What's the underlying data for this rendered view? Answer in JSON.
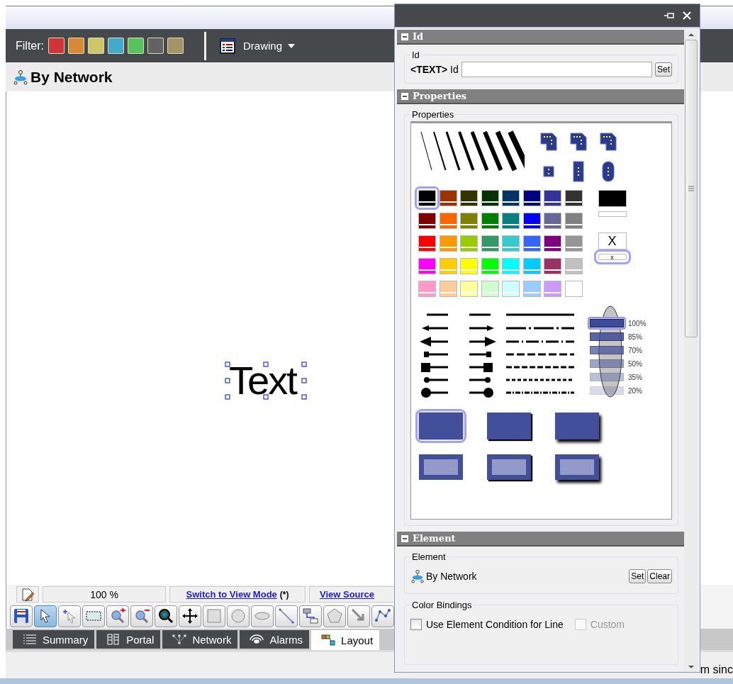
{
  "toolbar": {
    "filter_label": "Filter:",
    "filters": [
      {
        "color": "#d03434"
      },
      {
        "color": "#d88a34"
      },
      {
        "color": "#cfc66a"
      },
      {
        "color": "#44aacc"
      },
      {
        "color": "#56c45a"
      },
      {
        "color": "#626262"
      },
      {
        "color": "#a59468"
      }
    ],
    "view_menu": "Drawing"
  },
  "page_title": "By Network",
  "canvas": {
    "text_element": "Text",
    "selected": true
  },
  "status_row": {
    "zoom": "100 %",
    "switch_link": "Switch to View Mode",
    "switch_suffix": "(*)",
    "source_link": "View Source"
  },
  "tools": [
    {
      "kind": "save",
      "selected": false
    },
    {
      "kind": "pointer",
      "selected": true
    },
    {
      "kind": "add_pointer",
      "selected": false
    },
    {
      "kind": "marquee",
      "selected": false
    },
    {
      "kind": "zoom_in",
      "selected": false
    },
    {
      "kind": "zoom_out",
      "selected": false
    },
    {
      "kind": "zoom_fit",
      "selected": false
    },
    {
      "kind": "move",
      "selected": false
    },
    {
      "kind": "rectangle",
      "selected": false
    },
    {
      "kind": "circle",
      "selected": false
    },
    {
      "kind": "ellipse",
      "selected": false
    },
    {
      "kind": "line",
      "selected": false
    },
    {
      "kind": "connector",
      "selected": false
    },
    {
      "kind": "polygon",
      "selected": false
    },
    {
      "kind": "arrow",
      "selected": false
    },
    {
      "kind": "polyline",
      "selected": false
    }
  ],
  "tabs": [
    {
      "kind": "summary",
      "label": "Summary",
      "selected": false
    },
    {
      "kind": "portal",
      "label": "Portal",
      "selected": false
    },
    {
      "kind": "network",
      "label": "Network",
      "selected": false
    },
    {
      "kind": "alarms",
      "label": "Alarms",
      "selected": false
    },
    {
      "kind": "layout",
      "label": "Layout",
      "selected": true
    }
  ],
  "status_bar": {
    "text": "m sinc"
  },
  "panel": {
    "id_section": {
      "title": "Id",
      "group": "Id",
      "prefix": "<TEXT>",
      "label": "Id",
      "button": "Set"
    },
    "properties_section": {
      "title": "Properties",
      "group": "Properties",
      "colors": [
        {
          "color": "#000000",
          "selected": true
        },
        {
          "color": "#993300",
          "selected": false
        },
        {
          "color": "#333300",
          "selected": false
        },
        {
          "color": "#003300",
          "selected": false
        },
        {
          "color": "#003366",
          "selected": false
        },
        {
          "color": "#000080",
          "selected": false
        },
        {
          "color": "#333399",
          "selected": false
        },
        {
          "color": "#333333",
          "selected": false
        },
        {
          "color": "#800000",
          "selected": false
        },
        {
          "color": "#ff6600",
          "selected": false
        },
        {
          "color": "#808000",
          "selected": false
        },
        {
          "color": "#008000",
          "selected": false
        },
        {
          "color": "#008080",
          "selected": false
        },
        {
          "color": "#0000ff",
          "selected": false
        },
        {
          "color": "#666699",
          "selected": false
        },
        {
          "color": "#808080",
          "selected": false
        },
        {
          "color": "#ff0000",
          "selected": false
        },
        {
          "color": "#ff9900",
          "selected": false
        },
        {
          "color": "#99cc00",
          "selected": false
        },
        {
          "color": "#339966",
          "selected": false
        },
        {
          "color": "#33cccc",
          "selected": false
        },
        {
          "color": "#3366ff",
          "selected": false
        },
        {
          "color": "#800080",
          "selected": false
        },
        {
          "color": "#969696",
          "selected": false
        },
        {
          "color": "#ff00ff",
          "selected": false
        },
        {
          "color": "#ffcc00",
          "selected": false
        },
        {
          "color": "#ffff00",
          "selected": false
        },
        {
          "color": "#00ff00",
          "selected": false
        },
        {
          "color": "#00ffff",
          "selected": false
        },
        {
          "color": "#00ccff",
          "selected": false
        },
        {
          "color": "#993366",
          "selected": false
        },
        {
          "color": "#c0c0c0",
          "selected": false
        },
        {
          "color": "#ff99cc",
          "selected": false
        },
        {
          "color": "#ffcc99",
          "selected": false
        },
        {
          "color": "#ffff99",
          "selected": false
        },
        {
          "color": "#ccffcc",
          "selected": false
        },
        {
          "color": "#ccffff",
          "selected": false
        },
        {
          "color": "#99ccff",
          "selected": false
        },
        {
          "color": "#cc99ff",
          "selected": false
        },
        {
          "color": "#ffffff",
          "selected": false
        }
      ],
      "fill_modes": [
        {
          "kind": "solid",
          "selected": false
        },
        {
          "kind": "solid_thin",
          "selected": false
        },
        {
          "kind": "none",
          "symbol": "X",
          "selected": false
        },
        {
          "kind": "none_thin",
          "symbol": "x",
          "selected": true
        }
      ],
      "opacities": [
        {
          "label": "100%",
          "selected": true
        },
        {
          "label": "85%",
          "selected": false
        },
        {
          "label": "70%",
          "selected": false
        },
        {
          "label": "50%",
          "selected": false
        },
        {
          "label": "35%",
          "selected": false
        },
        {
          "label": "20%",
          "selected": false
        }
      ],
      "box_styles": [
        {
          "kind": "flat",
          "selected": true
        },
        {
          "kind": "shadow",
          "selected": false
        },
        {
          "kind": "shadow_large",
          "selected": false
        },
        {
          "kind": "inset",
          "selected": false
        },
        {
          "kind": "inset_shadow",
          "selected": false
        },
        {
          "kind": "inset_shadow_large",
          "selected": false
        }
      ]
    },
    "element_section": {
      "title": "Element",
      "group": "Element",
      "value": "By Network",
      "buttons": [
        "Set",
        "Clear"
      ],
      "bindings_group": "Color Bindings",
      "checkboxes": [
        {
          "label": "Use Element Condition for Line",
          "checked": false,
          "disabled": false
        },
        {
          "label": "Custom",
          "checked": false,
          "disabled": true
        }
      ]
    }
  }
}
